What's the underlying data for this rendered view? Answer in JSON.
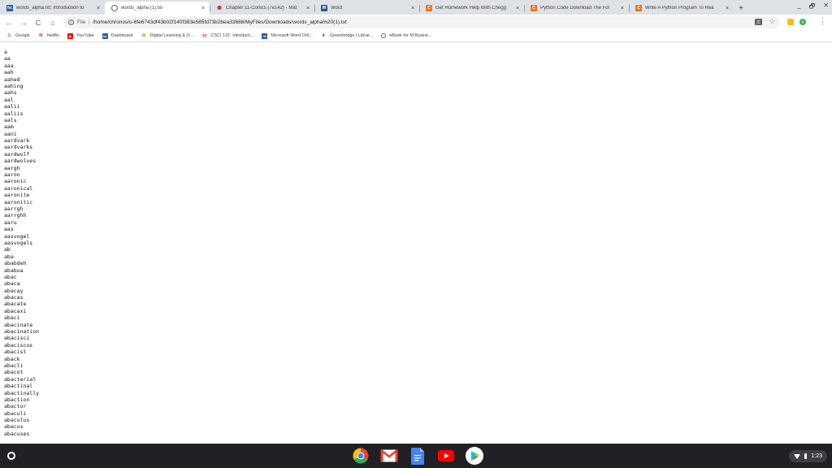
{
  "tabs": [
    {
      "icon": "hc-favicon",
      "icon_text": "hc",
      "title": "words_alpha.txt: Introduction to",
      "active": false
    },
    {
      "icon": "globe-icon",
      "icon_text": "",
      "title": "words_alpha (1).txt",
      "active": true
    },
    {
      "icon": "wolfram-icon",
      "icon_text": "✺",
      "title": "Chapter 11-Conics (7e142) - Mat",
      "active": false
    },
    {
      "icon": "word-icon",
      "icon_text": "W",
      "title": "Word",
      "active": false
    },
    {
      "icon": "chegg-icon",
      "icon_text": "C",
      "title": "Get Homework Help With Chegg",
      "active": false
    },
    {
      "icon": "chegg-icon",
      "icon_text": "C",
      "title": "Python Code Download The Fol",
      "active": false
    },
    {
      "icon": "chegg-icon",
      "icon_text": "C",
      "title": "Write A Python Program To Rea",
      "active": false
    }
  ],
  "tab_close_glyph": "×",
  "new_tab_glyph": "+",
  "window_controls": {
    "minimize": "_",
    "maximize": "🗗",
    "close": "✕"
  },
  "toolbar": {
    "back": "←",
    "forward": "→",
    "reload": "C",
    "home": "⌂",
    "url_scheme": "File",
    "url_separator": "|",
    "url": "/home/chronos/u-6fe6743df43b02f140f383e585fd73b2bea33688/MyFiles/Downloads/words_alpha%20(1).txt",
    "star": "☆",
    "translate": "文",
    "menu": "⋮"
  },
  "bookmarks": [
    {
      "icon": "google-icon",
      "glyph": "G",
      "label": "Google"
    },
    {
      "icon": "netflix-icon",
      "glyph": "N",
      "label": "Netflix"
    },
    {
      "icon": "youtube-icon",
      "glyph": "▶",
      "label": "YouTube"
    },
    {
      "icon": "hc-icon",
      "glyph": "hc",
      "label": "Dashboard"
    },
    {
      "icon": "d2l-icon",
      "glyph": "⁂",
      "label": "Digital Learning & O..."
    },
    {
      "icon": "zybooks-icon",
      "glyph": "zy",
      "label": "CSCI 131: Introduct..."
    },
    {
      "icon": "word-icon",
      "glyph": "W",
      "label": "Microsoft Word Onl..."
    },
    {
      "icon": "greenbridge-icon",
      "glyph": "➧",
      "label": "Greenbridge | Librar..."
    },
    {
      "icon": "globe-icon",
      "glyph": "",
      "label": "eBook for M Busine..."
    }
  ],
  "words": [
    "a",
    "aa",
    "aaa",
    "aah",
    "aahed",
    "aahing",
    "aahs",
    "aal",
    "aalii",
    "aaliis",
    "aals",
    "aam",
    "aani",
    "aardvark",
    "aardvarks",
    "aardwolf",
    "aardwolves",
    "aargh",
    "aaron",
    "aaronic",
    "aaronical",
    "aaronite",
    "aaronitic",
    "aarrgh",
    "aarrghh",
    "aaru",
    "aas",
    "aasvogel",
    "aasvogels",
    "ab",
    "aba",
    "ababdeh",
    "ababua",
    "abac",
    "abaca",
    "abacay",
    "abacas",
    "abacate",
    "abacaxi",
    "abaci",
    "abacinate",
    "abacination",
    "abacisci",
    "abaciscus",
    "abacist",
    "aback",
    "abacli",
    "abacot",
    "abacterial",
    "abactinal",
    "abactinally",
    "abaction",
    "abactor",
    "abaculi",
    "abaculus",
    "abacus",
    "abacuses"
  ],
  "shelf": {
    "apps": [
      "chrome-icon",
      "gmail-icon",
      "docs-icon",
      "youtube-icon",
      "play-store-icon"
    ],
    "time": "1:23"
  },
  "colors": {
    "chrome_red": "#ea4335",
    "chrome_yellow": "#fbbc05",
    "chrome_green": "#34a853",
    "chrome_blue": "#4285f4",
    "youtube_red": "#ff0000",
    "docs_blue": "#4285f4",
    "shelf_bg": "#202124"
  }
}
